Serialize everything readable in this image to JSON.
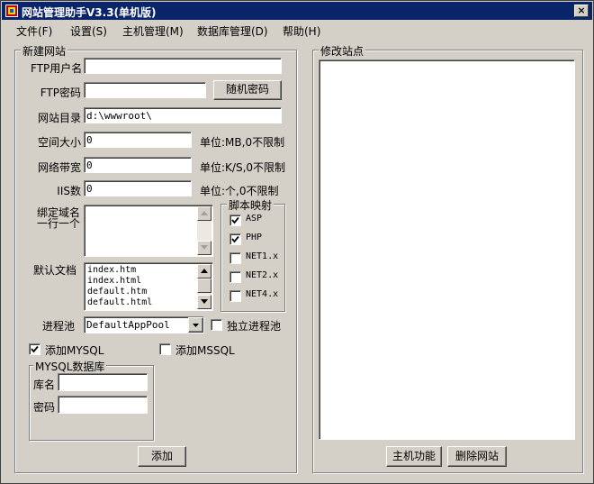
{
  "window": {
    "title": "网站管理助手V3.3(单机版)",
    "close_label": "×"
  },
  "menu": [
    "文件(F)",
    "设置(S)",
    "主机管理(M)",
    "数据库管理(D)",
    "帮助(H)"
  ],
  "new_site": {
    "group_title": "新建网站",
    "ftp_user_label": "FTP用户名",
    "ftp_user_value": "",
    "ftp_pass_label": "FTP密码",
    "ftp_pass_value": "",
    "random_pass_button": "随机密码",
    "site_dir_label": "网站目录",
    "site_dir_value": "d:\\wwwroot\\",
    "space_label": "空间大小",
    "space_value": "0",
    "space_unit": "单位:MB,0不限制",
    "bandwidth_label": "网络带宽",
    "bandwidth_value": "0",
    "bandwidth_unit": "单位:K/S,0不限制",
    "iis_label": "IIS数",
    "iis_value": "0",
    "iis_unit": "单位:个,0不限制",
    "bind_domain_label_1": "绑定域名",
    "bind_domain_label_2": "一行一个",
    "default_doc_label": "默认文档",
    "default_docs": [
      "index.htm",
      "index.html",
      "default.htm",
      "default.html"
    ],
    "script_group_title": "脚本映射",
    "scripts": [
      {
        "label": "ASP",
        "checked": true
      },
      {
        "label": "PHP",
        "checked": true
      },
      {
        "label": "NET1.x",
        "checked": false
      },
      {
        "label": "NET2.x",
        "checked": false
      },
      {
        "label": "NET4.x",
        "checked": false
      }
    ],
    "pool_label": "进程池",
    "pool_value": "DefaultAppPool",
    "independent_pool_label": "独立进程池",
    "add_mysql_label": "添加MYSQL",
    "add_mssql_label": "添加MSSQL",
    "mysql_group_title": "MYSQL数据库",
    "db_name_label": "库名",
    "db_name_value": "",
    "db_pass_label": "密码",
    "db_pass_value": "",
    "add_button": "添加"
  },
  "edit_site": {
    "group_title": "修改站点",
    "host_func_button": "主机功能",
    "delete_site_button": "删除网站"
  }
}
